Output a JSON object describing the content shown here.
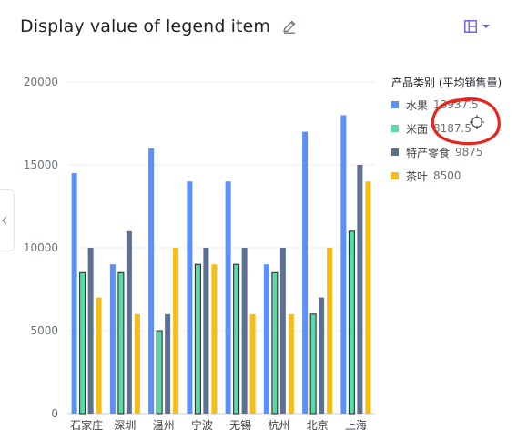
{
  "header": {
    "title": "Display value of legend item"
  },
  "legend": {
    "title": "产品类别 (平均销售量)",
    "items": [
      {
        "name": "水果",
        "value": "13937.5",
        "color": "#5b8ff9"
      },
      {
        "name": "米面",
        "value": "8187.5",
        "color": "#5ad8a6"
      },
      {
        "name": "特产零食",
        "value": "9875",
        "color": "#5d7092"
      },
      {
        "name": "茶叶",
        "value": "8500",
        "color": "#f6bd16"
      }
    ]
  },
  "colors": {
    "accent": "#6b5bd6",
    "annotation": "#e5261e"
  },
  "icons": {
    "edit": "pencil-icon",
    "layout": "layout-icon",
    "collapse": "chevron-left-icon",
    "cursor": "crosshair-icon"
  },
  "chart_data": {
    "type": "bar",
    "categories": [
      "石家庄",
      "深圳",
      "温州",
      "宁波",
      "无锡",
      "杭州",
      "北京",
      "上海"
    ],
    "series": [
      {
        "name": "水果",
        "values": [
          14500,
          9000,
          16000,
          14000,
          14000,
          9000,
          17000,
          18000
        ],
        "color": "#5b8ff9"
      },
      {
        "name": "米面",
        "values": [
          8500,
          8500,
          5000,
          9000,
          9000,
          8500,
          6000,
          11000
        ],
        "color": "#5ad8a6"
      },
      {
        "name": "特产零食",
        "values": [
          10000,
          11000,
          6000,
          10000,
          10000,
          10000,
          7000,
          15000
        ],
        "color": "#5d7092"
      },
      {
        "name": "茶叶",
        "values": [
          7000,
          6000,
          10000,
          9000,
          6000,
          6000,
          10000,
          14000
        ],
        "color": "#f6bd16"
      }
    ],
    "yticks": [
      "0",
      "5000",
      "10000",
      "15000",
      "20000"
    ],
    "ylim": [
      0,
      20000
    ],
    "grid": true,
    "legend_position": "right"
  }
}
